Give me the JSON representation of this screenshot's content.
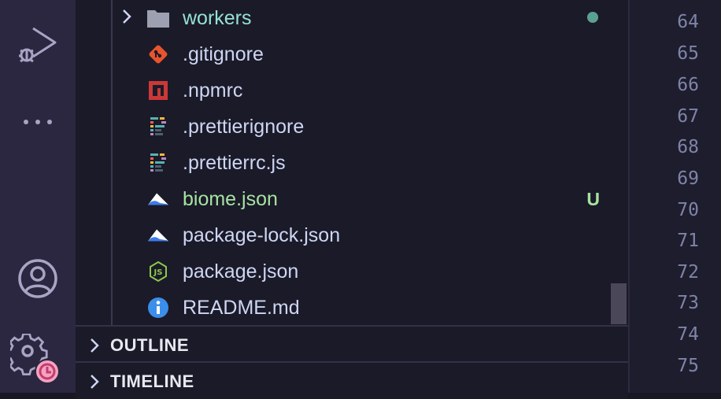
{
  "explorer": {
    "items": [
      {
        "name": "workers",
        "kind": "folder",
        "status": "modified-dot"
      },
      {
        "name": ".gitignore",
        "kind": "file",
        "icon": "git-icon"
      },
      {
        "name": ".npmrc",
        "kind": "file",
        "icon": "npm-icon"
      },
      {
        "name": ".prettierignore",
        "kind": "file",
        "icon": "prettier-icon"
      },
      {
        "name": ".prettierrc.js",
        "kind": "file",
        "icon": "prettier-icon"
      },
      {
        "name": "biome.json",
        "kind": "file",
        "icon": "biome-icon",
        "status": "U"
      },
      {
        "name": "package-lock.json",
        "kind": "file",
        "icon": "biome-icon"
      },
      {
        "name": "package.json",
        "kind": "file",
        "icon": "nodejs-icon"
      },
      {
        "name": "README.md",
        "kind": "file",
        "icon": "info-icon"
      }
    ],
    "sections": {
      "outline": "OUTLINE",
      "timeline": "TIMELINE"
    }
  },
  "editor": {
    "line_numbers": [
      "64",
      "65",
      "66",
      "67",
      "68",
      "69",
      "70",
      "71",
      "72",
      "73",
      "74",
      "75"
    ]
  },
  "colors": {
    "accent_added": "#a6e3a1",
    "folder_text": "#94e2d5",
    "text": "#cdd6f4",
    "badge_clock": "#f38ba8"
  }
}
